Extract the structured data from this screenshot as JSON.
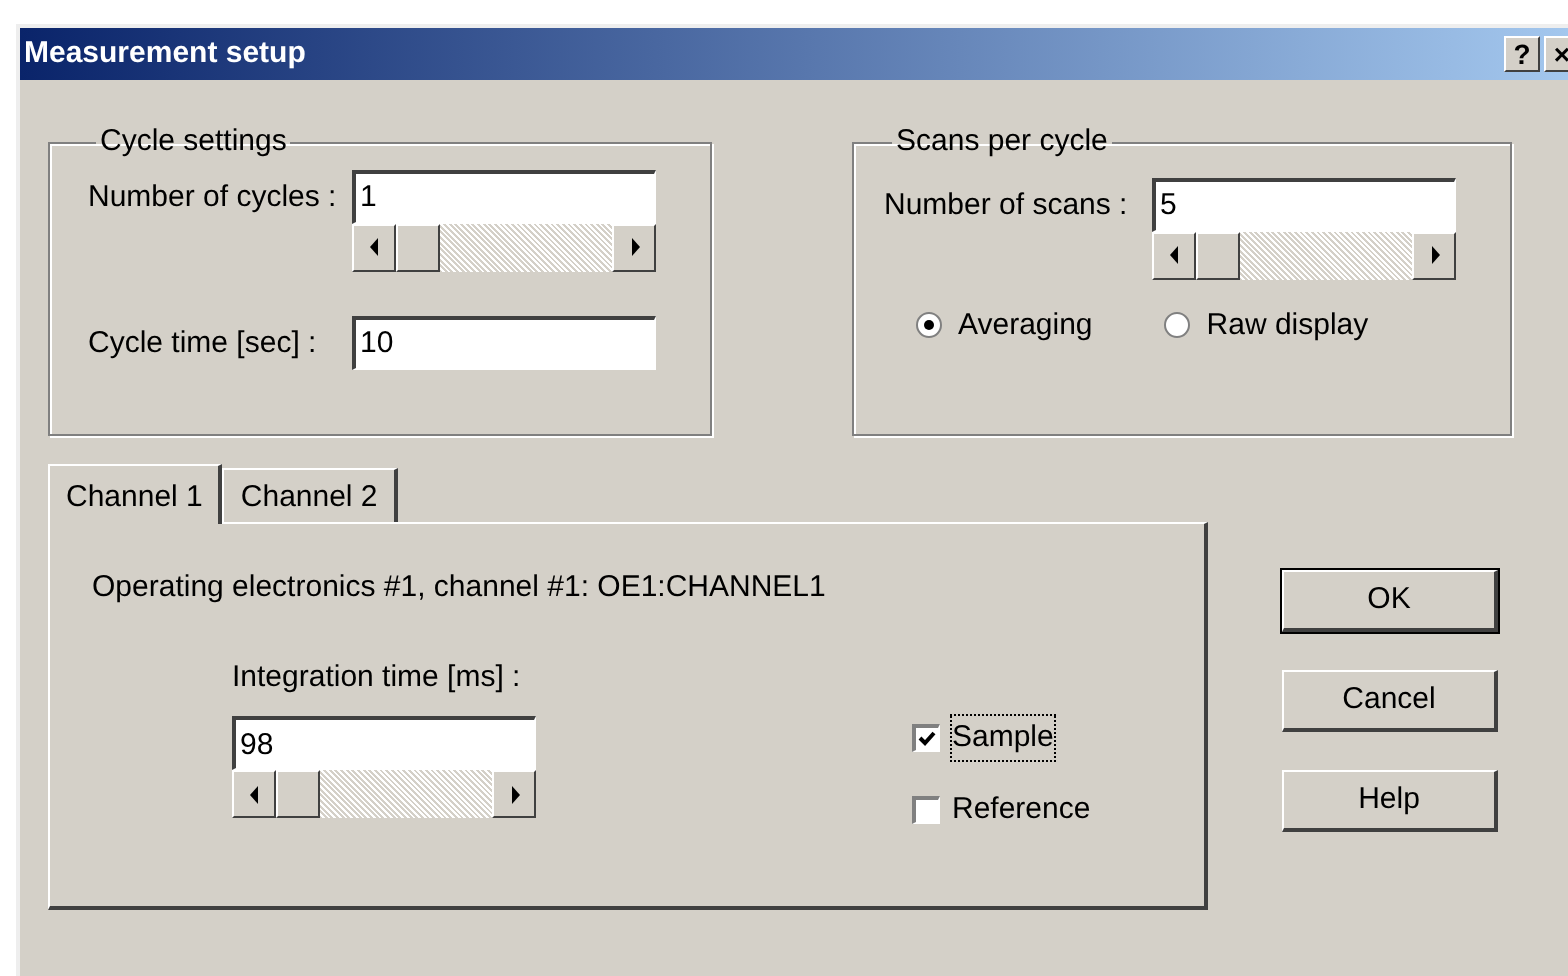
{
  "window": {
    "title": "Measurement setup",
    "title_buttons": [
      "?",
      "×"
    ]
  },
  "cycle_settings": {
    "title": "Cycle settings",
    "fields": [
      {
        "label": "Number of cycles :",
        "value": "1",
        "kind": "scroll"
      },
      {
        "label": "Cycle time [sec] :",
        "value": "10",
        "kind": "plain"
      }
    ]
  },
  "scans_per_cycle": {
    "title": "Scans per cycle",
    "field": {
      "label": "Number of scans :",
      "value": "5"
    },
    "radios": [
      {
        "label": "Averaging",
        "selected": true
      },
      {
        "label": "Raw display",
        "selected": false
      }
    ]
  },
  "tabs": [
    {
      "label": "Channel 1",
      "selected": true
    },
    {
      "label": "Channel 2",
      "selected": false
    }
  ],
  "channel": {
    "description": "Operating electronics #1, channel #1: OE1:CHANNEL1",
    "integration_label": "Integration time [ms] :",
    "integration_value": "98",
    "checkboxes": [
      {
        "label": "Sample",
        "checked": true,
        "focused": true
      },
      {
        "label": "Reference",
        "checked": false,
        "focused": false
      }
    ]
  },
  "buttons": [
    {
      "label": "OK",
      "default": true
    },
    {
      "label": "Cancel",
      "default": false
    },
    {
      "label": "Help",
      "default": false
    }
  ]
}
